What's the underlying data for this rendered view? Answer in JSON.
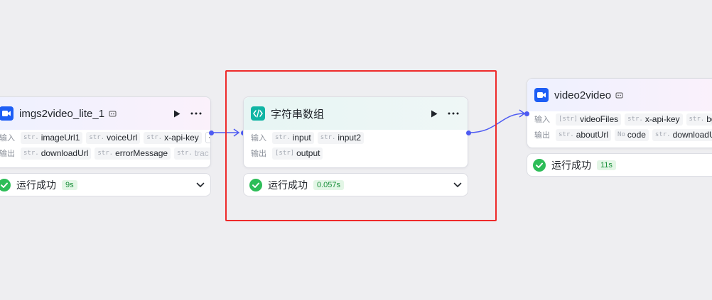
{
  "io_labels": {
    "input": "输入",
    "output": "输出"
  },
  "status_text": "运行成功",
  "colors": {
    "canvas_bg": "#eeeef1",
    "accent_blue": "#1d5ef5",
    "accent_teal": "#10b5a4",
    "success_green": "#2dbd58",
    "connector": "#4e5bf2",
    "highlight_red": "#ee2a2a"
  },
  "nodes": [
    {
      "title": "imgs2video_lite_1",
      "icon": "video-camera-icon",
      "inputs": [
        {
          "type": "str.",
          "name": "imageUrl1"
        },
        {
          "type": "str.",
          "name": "voiceUrl"
        },
        {
          "type": "str.",
          "name": "x-api-key"
        }
      ],
      "outputs": [
        {
          "type": "str.",
          "name": "downloadUrl"
        },
        {
          "type": "str.",
          "name": "errorMessage"
        },
        {
          "type": "str.",
          "name": "trac"
        }
      ],
      "more_label": "···",
      "status": {
        "time": "9s"
      }
    },
    {
      "title": "字符串数组",
      "icon": "code-brackets-icon",
      "inputs": [
        {
          "type": "str.",
          "name": "input"
        },
        {
          "type": "str.",
          "name": "input2"
        }
      ],
      "outputs": [
        {
          "type": "[str]",
          "name": "output"
        }
      ],
      "status": {
        "time": "0.057s"
      }
    },
    {
      "title": "video2video",
      "icon": "video-camera-icon",
      "inputs": [
        {
          "type": "[str]",
          "name": "videoFiles"
        },
        {
          "type": "str.",
          "name": "x-api-key"
        },
        {
          "type": "str.",
          "name": "bgmUrl"
        }
      ],
      "outputs": [
        {
          "type": "str.",
          "name": "aboutUrl"
        },
        {
          "type": "No",
          "name": "code"
        },
        {
          "type": "str.",
          "name": "downloadUrl"
        }
      ],
      "status": {
        "time": "11s"
      }
    }
  ]
}
